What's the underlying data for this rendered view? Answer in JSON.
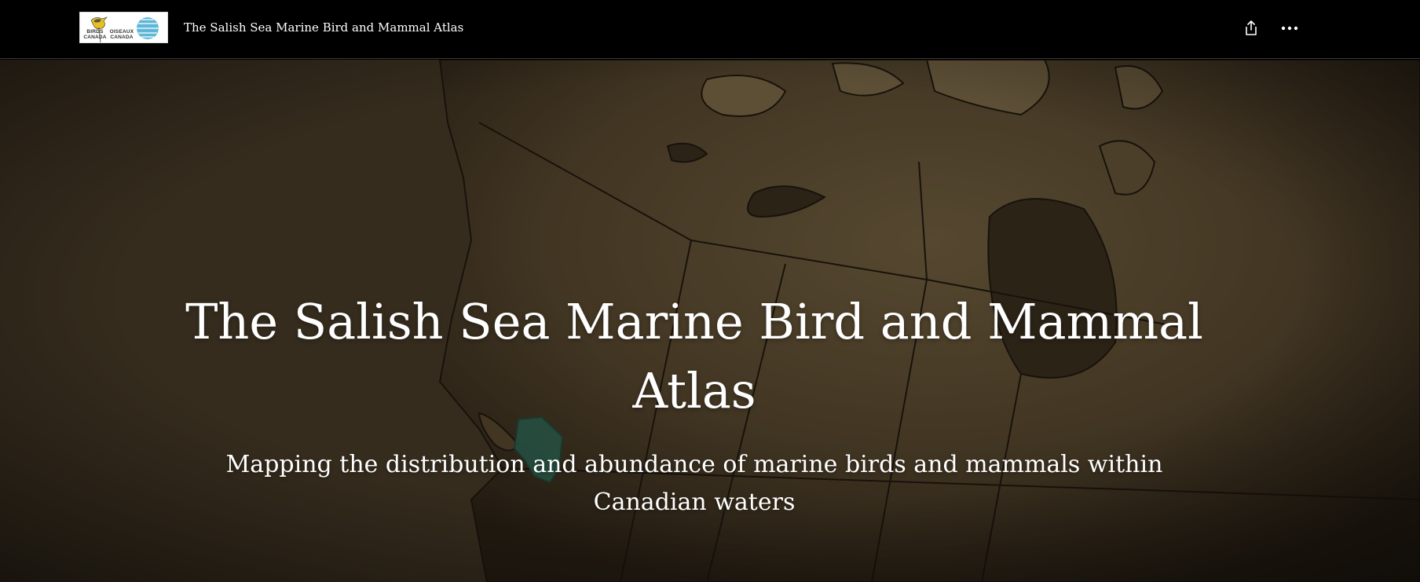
{
  "header": {
    "logo": {
      "text_en": "BIRDS CANADA",
      "text_fr": "OISEAUX CANADA"
    },
    "title": "The Salish Sea Marine Bird and Mammal Atlas",
    "actions": [
      {
        "name": "share",
        "icon": "share-icon"
      },
      {
        "name": "more",
        "icon": "more-options-icon"
      }
    ]
  },
  "hero": {
    "title": "The Salish Sea Marine Bird and Mammal Atlas",
    "subtitle": "Mapping the distribution and abundance of marine birds and mammals within Canadian waters",
    "background": "map-of-canada",
    "highlight_region_color": "#2e7a66"
  },
  "colors": {
    "topbar": "#000000",
    "text": "#ffffff",
    "map_land": "#6e5d3e",
    "map_outline": "#1a140c"
  }
}
